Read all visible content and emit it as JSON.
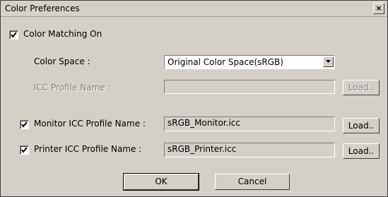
{
  "dialog": {
    "title": "Color Preferences",
    "close_label": "×"
  },
  "color_matching": {
    "label": "Color Matching On",
    "checked": true
  },
  "color_space": {
    "label": "Color Space :",
    "selected": "Original Color Space(sRGB)"
  },
  "icc_profile": {
    "label": "ICC Profile Name :",
    "value": "",
    "load_label": "Load..",
    "disabled": true
  },
  "monitor": {
    "label": "Monitor ICC Profile Name :",
    "value": "sRGB_Monitor.icc",
    "load_label": "Load..",
    "checked": true
  },
  "printer": {
    "label": "Printer ICC Profile Name :",
    "value": "sRGB_Printer.icc",
    "load_label": "Load..",
    "checked": true
  },
  "buttons": {
    "ok": "OK",
    "cancel": "Cancel"
  }
}
